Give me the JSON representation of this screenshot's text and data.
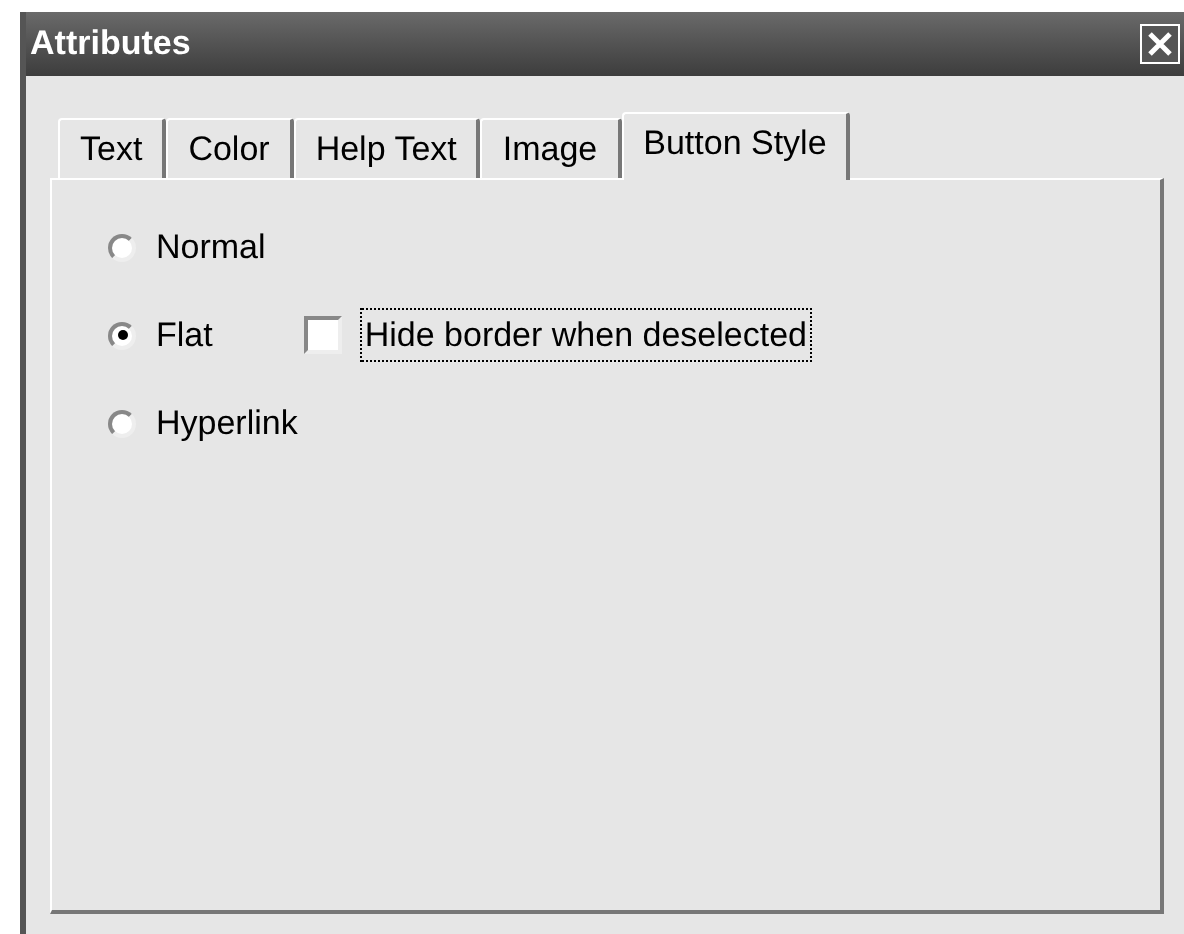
{
  "window": {
    "title": "Attributes"
  },
  "tabs": [
    {
      "label": "Text",
      "selected": false
    },
    {
      "label": "Color",
      "selected": false
    },
    {
      "label": "Help Text",
      "selected": false
    },
    {
      "label": "Image",
      "selected": false
    },
    {
      "label": "Button Style",
      "selected": true
    }
  ],
  "styles": [
    {
      "label": "Normal",
      "selected": false
    },
    {
      "label": "Flat",
      "selected": true
    },
    {
      "label": "Hyperlink",
      "selected": false
    }
  ],
  "hide_border": {
    "label": "Hide border when deselected",
    "checked": false,
    "focused": true
  }
}
